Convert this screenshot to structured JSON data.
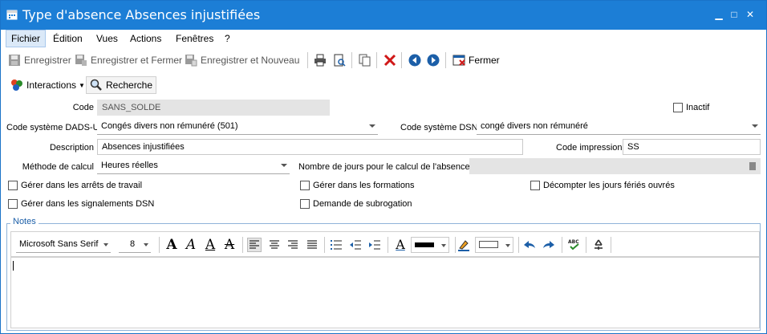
{
  "window": {
    "title": "Type d'absence Absences injustifiées",
    "minimize": "▁",
    "maximize": "□",
    "close": "✕"
  },
  "menu": [
    "Fichier",
    "Édition",
    "Vues",
    "Actions",
    "Fenêtres",
    "?"
  ],
  "toolbar": {
    "save": "Enregistrer",
    "save_close": "Enregistrer et Fermer",
    "save_new": "Enregistrer et Nouveau",
    "close": "Fermer"
  },
  "bar2": {
    "interactions": "Interactions",
    "search": "Recherche"
  },
  "form": {
    "code_label": "Code",
    "code_value": "SANS_SOLDE",
    "inactive_label": "Inactif",
    "dads_label": "Code système DADS-U",
    "dads_value": "Congés divers non rémunéré (501)",
    "dsn_label": "Code système DSN",
    "dsn_value": "congé divers non rémunéré",
    "desc_label": "Description",
    "desc_value": "Absences injustifiées",
    "print_label": "Code impression",
    "print_value": "SS",
    "method_label": "Méthode de calcul",
    "method_value": "Heures réelles",
    "days_label": "Nombre de jours pour le calcul de l'absence",
    "chk_work_stop": "Gérer dans les arrêts de travail",
    "chk_training": "Gérer dans les formations",
    "chk_holidays": "Décompter les jours fériés ouvrés",
    "chk_dsn": "Gérer dans les signalements DSN",
    "chk_subrogation": "Demande de subrogation"
  },
  "notes": {
    "legend": "Notes",
    "font": "Microsoft Sans Serif",
    "size": "8",
    "icon_bold": "A",
    "icon_italic": "A",
    "icon_underline": "A",
    "icon_strike": "A",
    "icon_fontcolor": "A"
  }
}
